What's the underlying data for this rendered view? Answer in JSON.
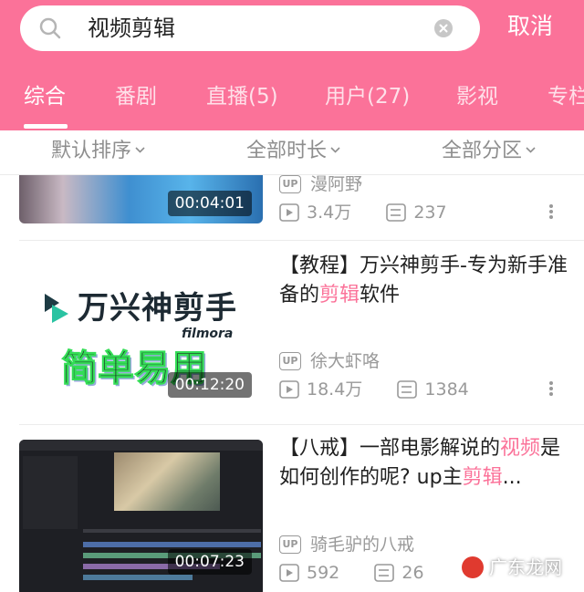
{
  "search": {
    "query": "视频剪辑",
    "cancel_label": "取消"
  },
  "tabs": [
    {
      "label": "综合"
    },
    {
      "label": "番剧"
    },
    {
      "label": "直播(5)"
    },
    {
      "label": "用户(27)"
    },
    {
      "label": "影视"
    },
    {
      "label": "专栏"
    }
  ],
  "filters": {
    "sort": "默认排序",
    "duration": "全部时长",
    "category": "全部分区"
  },
  "videos": [
    {
      "duration": "00:04:01",
      "title": "",
      "uploader": "漫阿野",
      "views": "3.4万",
      "comments": "237"
    },
    {
      "duration": "00:12:20",
      "title_parts": [
        "【教程】万兴神剪手-专为新手准备的",
        "剪辑",
        "软件"
      ],
      "thumb_brand": "万兴神剪手",
      "thumb_sub": "filmora",
      "thumb_caption": "简单易用",
      "uploader": "徐大虾咯",
      "views": "18.4万",
      "comments": "1384"
    },
    {
      "duration": "00:07:23",
      "title_parts": [
        "【八戒】一部电影解说的",
        "视频",
        "是如何创作的呢? up主",
        "剪辑",
        "..."
      ],
      "uploader": "骑毛驴的八戒",
      "views": "592",
      "comments": "26"
    }
  ],
  "up_badge": "UP",
  "watermark": "广东龙网",
  "colors": {
    "brand": "#fb7299",
    "muted": "#999999"
  }
}
